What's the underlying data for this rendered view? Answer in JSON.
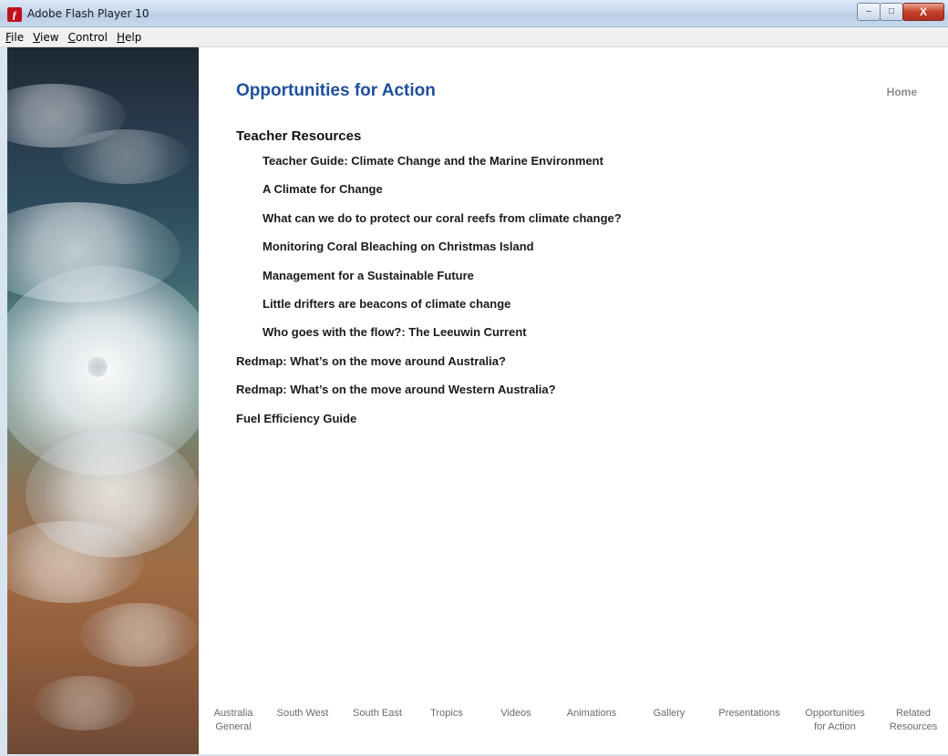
{
  "window": {
    "title": "Adobe Flash Player 10",
    "icon": "flash-icon",
    "controls": {
      "minimize": "–",
      "maximize": "□",
      "close": "X"
    }
  },
  "menu": {
    "items": [
      {
        "key": "F",
        "rest": "ile"
      },
      {
        "key": "V",
        "rest": "iew"
      },
      {
        "key": "C",
        "rest": "ontrol"
      },
      {
        "key": "H",
        "rest": "elp"
      }
    ]
  },
  "page": {
    "title": "Opportunities for Action",
    "home_label": "Home",
    "title_color": "#1f4f9c"
  },
  "resources": {
    "heading": "Teacher Resources",
    "teacher_links": [
      "Teacher Guide: Climate Change and the Marine Environment",
      "A Climate for Change",
      "What can we do to protect our coral reefs from climate change?",
      "Monitoring Coral Bleaching on Christmas Island",
      "Management for a Sustainable Future",
      "Little drifters are beacons of climate change",
      "Who goes with the flow?: The Leeuwin Current"
    ],
    "other_links": [
      "Redmap: What’s on the move around Australia?",
      "Redmap: What’s on the move around Western Australia?",
      "Fuel Efficiency Guide"
    ]
  },
  "bottom_nav": [
    "Australia\nGeneral",
    "South West",
    "South East",
    "Tropics",
    "Videos",
    "Animations",
    "Gallery",
    "Presentations",
    "Opportunities\nfor Action",
    "Related\nResources"
  ]
}
